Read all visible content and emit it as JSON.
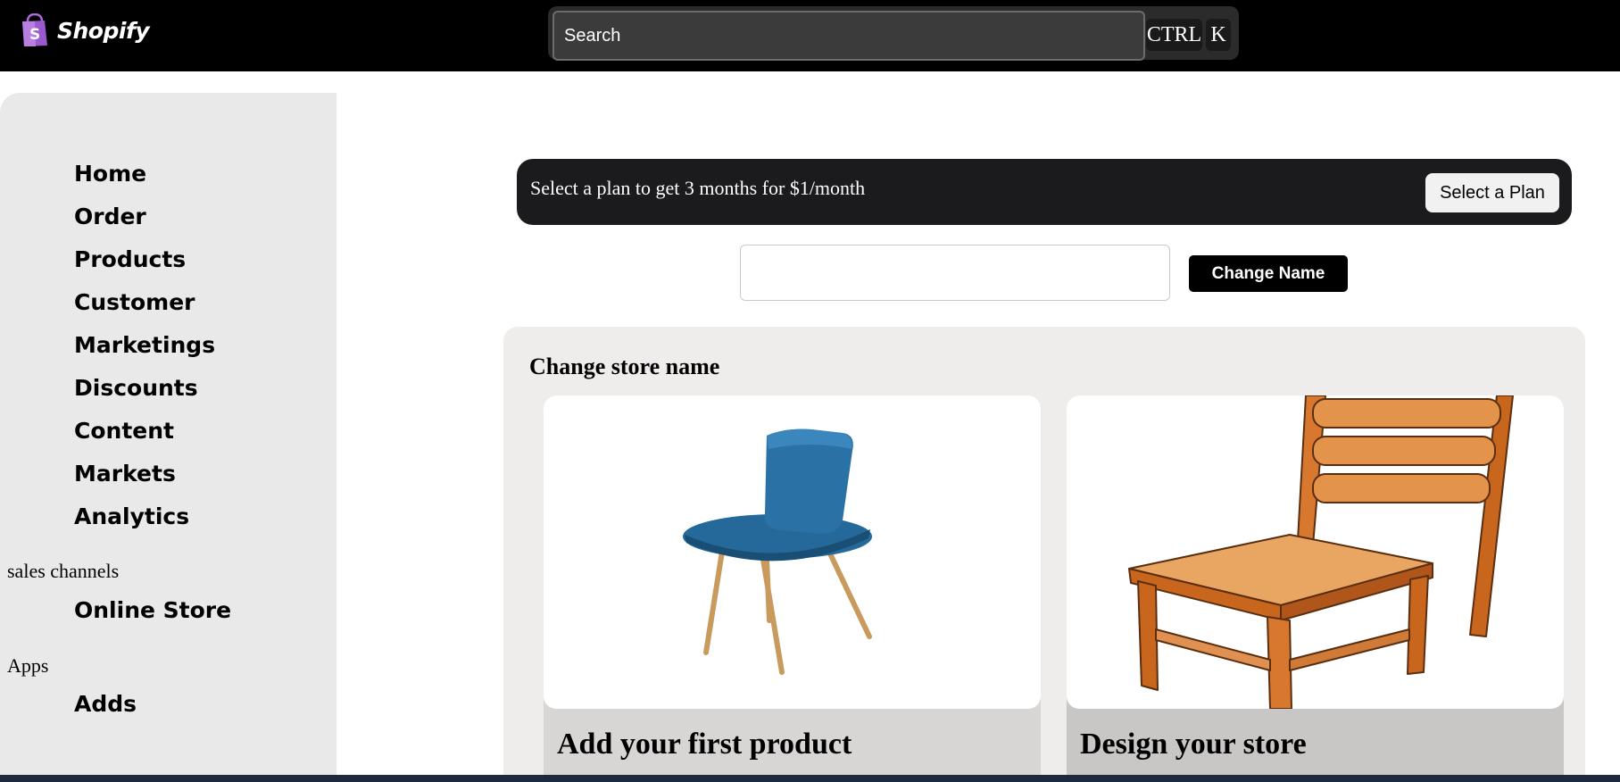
{
  "header": {
    "brand": "Shopify",
    "search": {
      "placeholder": "Search",
      "value": ""
    },
    "shortcut": {
      "key1": "CTRL",
      "key2": "K"
    }
  },
  "sidebar": {
    "items": [
      {
        "label": "Home"
      },
      {
        "label": "Order"
      },
      {
        "label": "Products"
      },
      {
        "label": "Customer"
      },
      {
        "label": "Marketings"
      },
      {
        "label": "Discounts"
      },
      {
        "label": "Content"
      },
      {
        "label": "Markets"
      },
      {
        "label": "Analytics"
      }
    ],
    "sales_channels": {
      "heading": "sales channels",
      "items": [
        {
          "label": "Online Store"
        }
      ]
    },
    "apps": {
      "heading": "Apps",
      "items": [
        {
          "label": "Adds"
        }
      ]
    }
  },
  "banner": {
    "text": "Select a plan to get 3 months for $1/month",
    "button_label": "Select a Plan"
  },
  "store_name": {
    "input_value": "",
    "button_label": "Change Name"
  },
  "panel": {
    "title": "Change store name",
    "cards": [
      {
        "title": "Add your first product",
        "image": "blue-chair"
      },
      {
        "title": "Design your store",
        "image": "wooden-chair"
      }
    ]
  },
  "colors": {
    "topbar": "#000000",
    "sidebar": "#e9e9e9",
    "banner": "#1b1b1d",
    "panel": "#efecec"
  }
}
